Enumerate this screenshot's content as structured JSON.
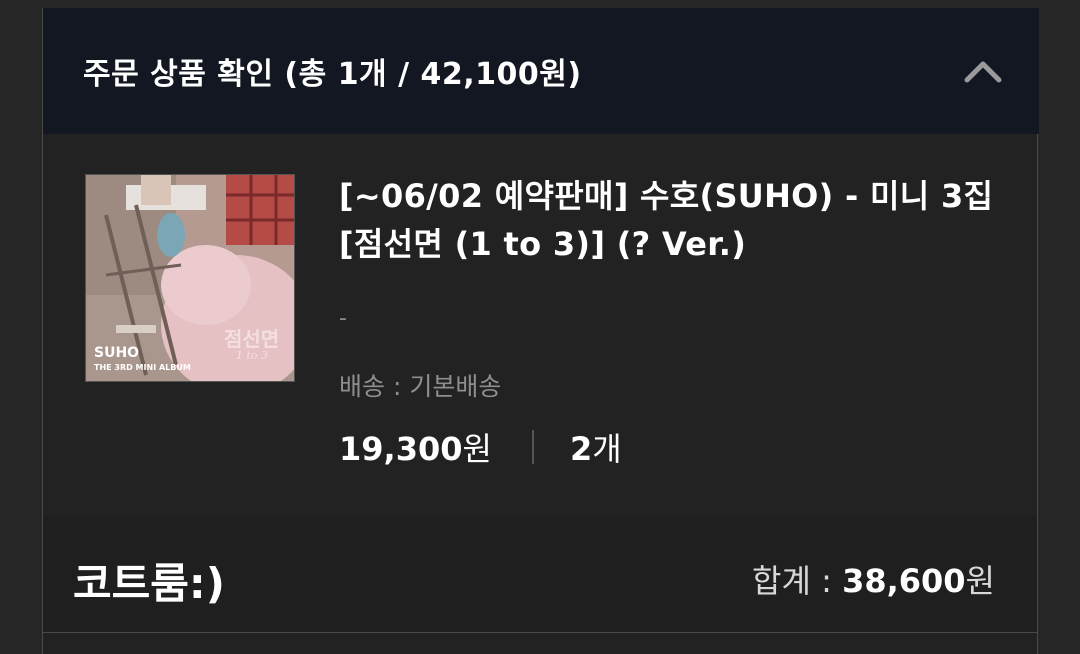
{
  "order": {
    "title": "주문 상품 확인 (총 1개 / 42,100원)",
    "toggle_icon": "chevron-up-icon"
  },
  "product": {
    "name": "[~06/02 예약판매] 수호(SUHO) - 미니 3집 [점선면 (1 to 3)] (? Ver.)",
    "album_cover": {
      "brand": "SUHO",
      "subtitle": "THE 3RD MINI ALBUM",
      "logo_text": "점선면",
      "logo_sub": "1 to 3"
    },
    "option": "-",
    "shipping": "배송 : 기본배송",
    "unit_price": "19,300",
    "price_unit": "원",
    "quantity": "2",
    "quantity_unit": "개"
  },
  "summary": {
    "shop_name": "코트룸:)",
    "total_label": "합계 : ",
    "total_value": "38,600",
    "total_unit": "원"
  },
  "colors": {
    "header_bg": "#121722",
    "panel_bg": "#222222",
    "summary_bg": "#1f1f1f",
    "muted_text": "#8e8e8e"
  }
}
